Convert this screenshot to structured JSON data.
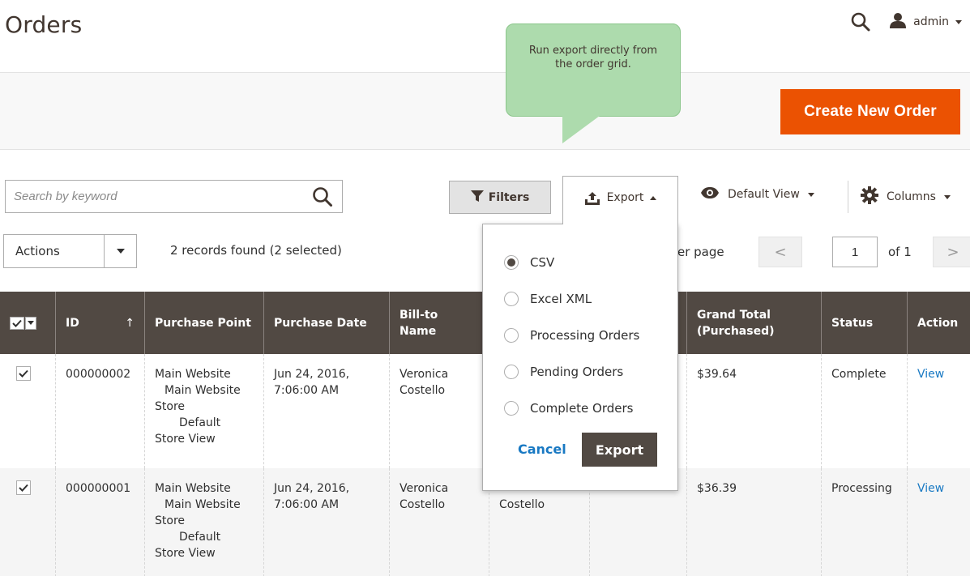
{
  "page": {
    "title": "Orders"
  },
  "header": {
    "user_name": "admin"
  },
  "action_bar": {
    "create_button_label": "Create New Order"
  },
  "tooltip": {
    "text": "Run export directly from the order grid."
  },
  "toolbar": {
    "search_placeholder": "Search by keyword",
    "filters_label": "Filters",
    "export_label": "Export",
    "default_view_label": "Default View",
    "columns_label": "Columns"
  },
  "mass_actions": {
    "label": "Actions"
  },
  "records": {
    "text": "2 records found (2 selected)"
  },
  "pagination": {
    "per_page_text": "er page",
    "prev_symbol": "<",
    "next_symbol": ">",
    "current_page": "1",
    "of_text": "of 1"
  },
  "export_panel": {
    "options": [
      {
        "label": "CSV",
        "selected": true
      },
      {
        "label": "Excel XML",
        "selected": false
      },
      {
        "label": "Processing Orders",
        "selected": false
      },
      {
        "label": "Pending Orders",
        "selected": false
      },
      {
        "label": "Complete Orders",
        "selected": false
      }
    ],
    "cancel_label": "Cancel",
    "export_label": "Export"
  },
  "grid": {
    "columns": {
      "id": "ID",
      "id_sort": "↑",
      "purchase_point": "Purchase Point",
      "purchase_date": "Purchase Date",
      "bill_to_line1": "Bill-to",
      "bill_to_line2": "Name",
      "grand_total_line1": "Grand Total",
      "grand_total_line2": "(Purchased)",
      "status": "Status",
      "action": "Action"
    },
    "rows": [
      {
        "checked": true,
        "id": "000000002",
        "purchase_point": [
          "Main Website",
          "Main Website",
          "Store",
          "Default",
          "Store View"
        ],
        "purchase_date": [
          "Jun 24, 2016,",
          "7:06:00 AM"
        ],
        "bill_to": [
          "Veronica",
          "Costello"
        ],
        "ship_to": "",
        "grand_total": "$39.64",
        "status": "Complete",
        "action": "View"
      },
      {
        "checked": true,
        "id": "000000001",
        "purchase_point": [
          "Main Website",
          "Main Website",
          "Store",
          "Default",
          "Store View"
        ],
        "purchase_date": [
          "Jun 24, 2016,",
          "7:06:00 AM"
        ],
        "bill_to": [
          "Veronica",
          "Costello"
        ],
        "ship_to": "Costello",
        "grand_total": "$36.39",
        "status": "Processing",
        "action": "View"
      }
    ]
  },
  "colors": {
    "accent": "#eb5202",
    "grid_header": "#514943",
    "link": "#1979c3",
    "tooltip_bg": "#addbad"
  },
  "icons": {
    "search": "search-icon",
    "user": "user-icon",
    "filter": "filter-icon",
    "export": "export-icon",
    "eye": "eye-icon",
    "gear": "gear-icon"
  }
}
